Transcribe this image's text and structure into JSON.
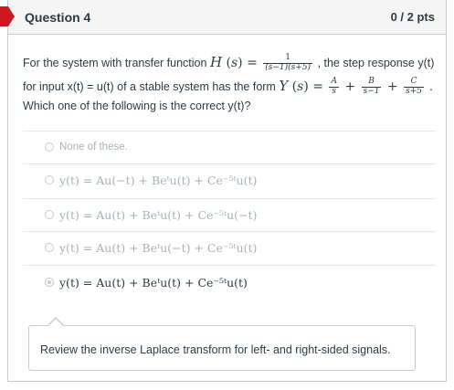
{
  "question": {
    "title": "Question 4",
    "points": "0 / 2 pts",
    "text_part1": "For the system with transfer function",
    "text_part2": ", the step response y(t)",
    "text_part3": "for input x(t) = u(t) of a stable system has the form",
    "text_part4": "Which one of the following is the correct y(t)?"
  },
  "answers": [
    {
      "text": "None of these.",
      "selected": false
    },
    {
      "text": "y(t) = Au(−t) + Beᵗu(t) + Ce⁻⁵ᵗu(t)",
      "selected": false
    },
    {
      "text": "y(t) = Au(t) + Beᵗu(t) + Ce⁻⁵ᵗu(−t)",
      "selected": false
    },
    {
      "text": "y(t) = Au(t) + Beᵗu(−t) + Ce⁻⁵ᵗu(t)",
      "selected": false
    },
    {
      "text": "y(t) = Au(t) + Beᵗu(t) + Ce⁻⁵ᵗu(t)",
      "selected": true
    }
  ],
  "feedback": {
    "text": "Review the inverse Laplace transform for left- and right-sided signals."
  },
  "colors": {
    "flag": "#d0161e",
    "border": "#c7cdd1",
    "header_bg": "#f5f5f5",
    "text": "#2d3b45",
    "faded": "#a9b2b8"
  }
}
